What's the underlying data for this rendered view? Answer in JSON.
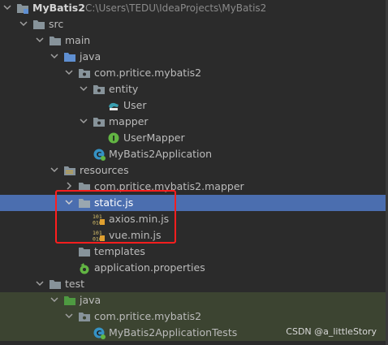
{
  "project": {
    "name": "MyBatis2",
    "path": "C:\\Users\\TEDU\\IdeaProjects\\MyBatis2"
  },
  "tree": {
    "src": "src",
    "main": "main",
    "java": "java",
    "package_main": "com.pritice.mybatis2",
    "entity": "entity",
    "user": "User",
    "mapper": "mapper",
    "user_mapper": "UserMapper",
    "app": "MyBatis2Application",
    "resources": "resources",
    "package_mapper": "com.pritice.mybatis2.mapper",
    "static_js": "static.js",
    "axios": "axios.min.js",
    "vue": "vue.min.js",
    "templates": "templates",
    "app_props": "application.properties",
    "test": "test",
    "test_java": "java",
    "package_test": "com.pritice.mybatis2",
    "app_tests": "MyBatis2ApplicationTests"
  },
  "watermark": "CSDN @a_littleStory",
  "colors": {
    "background": "#2b2b2b",
    "selected_row": "#4b6eaf",
    "test_rows": "#3c4431",
    "highlight_border": "#ff1e1e",
    "folder": "#87939a",
    "source_folder": "#5f8fd1",
    "test_folder": "#4e9a41"
  }
}
